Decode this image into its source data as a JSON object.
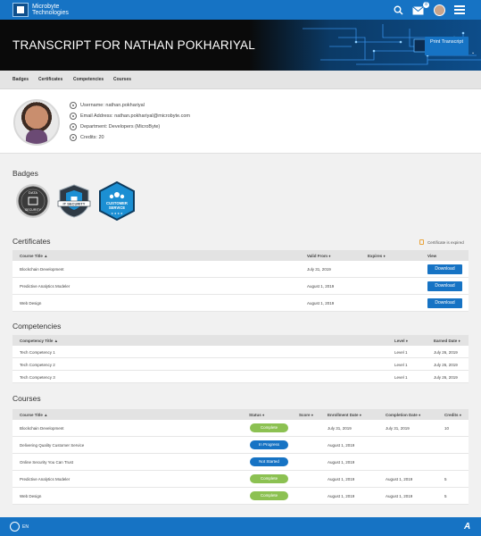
{
  "app": {
    "logo_text": "Microbyte Technologies",
    "mail_count": "8"
  },
  "banner": {
    "title": "TRANSCRIPT FOR NATHAN POKHARIYAL",
    "print_label": "Print Transcript",
    "dropdown_glyph": "⌄"
  },
  "subnav": [
    "Badges",
    "Certificates",
    "Competencies",
    "Courses"
  ],
  "profile": {
    "username": "Username: nathan.pokhariyal",
    "email": "Email Address: nathan.pokhariyal@microbyte.com",
    "department": "Department: Developers (MicroByte)",
    "credits": "Credits: 20"
  },
  "badges": {
    "title": "Badges",
    "items": [
      {
        "top": "DATA",
        "bottom": "SECURITY",
        "color": "#3b3b3b"
      },
      {
        "top": "",
        "bottom": "IT SECURITY",
        "color": "#2f3a45"
      },
      {
        "top": "CUSTOMER",
        "bottom": "SERVICE",
        "color": "#1c8fd3"
      }
    ]
  },
  "certificates": {
    "title": "Certificates",
    "expired_note": "Certificate is expired",
    "headers": [
      "Course Title ▲",
      "Valid From ♦",
      "Expires ♦",
      "View"
    ],
    "rows": [
      {
        "course": "Blockchain Development",
        "valid_from": "July 31, 2019",
        "expires": "",
        "view": "Download"
      },
      {
        "course": "Predictive Analytics Modeler",
        "valid_from": "August 1, 2019",
        "expires": "",
        "view": "Download"
      },
      {
        "course": "Web Design",
        "valid_from": "August 1, 2019",
        "expires": "",
        "view": "Download"
      }
    ]
  },
  "competencies": {
    "title": "Competencies",
    "headers": [
      "Competency Title ▲",
      "Level ♦",
      "Earned Date ♦"
    ],
    "rows": [
      {
        "title": "Tech Competency 1",
        "level": "Level 1",
        "date": "July 26, 2019"
      },
      {
        "title": "Tech Competency 2",
        "level": "Level 1",
        "date": "July 26, 2019"
      },
      {
        "title": "Tech Competency 3",
        "level": "Level 1",
        "date": "July 26, 2019"
      }
    ]
  },
  "courses": {
    "title": "Courses",
    "headers": [
      "Course Title ▲",
      "Status ♦",
      "Score ♦",
      "Enrollment Date ♦",
      "Completion Date ♦",
      "Credits ♦"
    ],
    "rows": [
      {
        "title": "Blockchain Development",
        "status": "Complete",
        "status_color": "#8cc152",
        "score": "",
        "enrolled": "July 31, 2019",
        "completed": "July 31, 2019",
        "credits": "10"
      },
      {
        "title": "Delivering Quality Customer Service",
        "status": "In Progress",
        "status_color": "#1673c4",
        "score": "",
        "enrolled": "August 1, 2019",
        "completed": "",
        "credits": ""
      },
      {
        "title": "Online Security You Can Trust",
        "status": "Not Started",
        "status_color": "#1673c4",
        "score": "",
        "enrolled": "August 1, 2019",
        "completed": "",
        "credits": ""
      },
      {
        "title": "Predictive Analytics Modeler",
        "status": "Complete",
        "status_color": "#8cc152",
        "score": "",
        "enrolled": "August 1, 2019",
        "completed": "August 1, 2019",
        "credits": "5"
      },
      {
        "title": "Web Design",
        "status": "Complete",
        "status_color": "#8cc152",
        "score": "",
        "enrolled": "August 1, 2019",
        "completed": "August 1, 2019",
        "credits": "5"
      }
    ]
  },
  "footer": {
    "language": "EN"
  },
  "icons": {
    "search": "search-icon",
    "mail": "mail-icon",
    "menu": "hamburger-menu-icon",
    "globe": "globe-icon",
    "footer_logo": "brand-logo-icon"
  }
}
